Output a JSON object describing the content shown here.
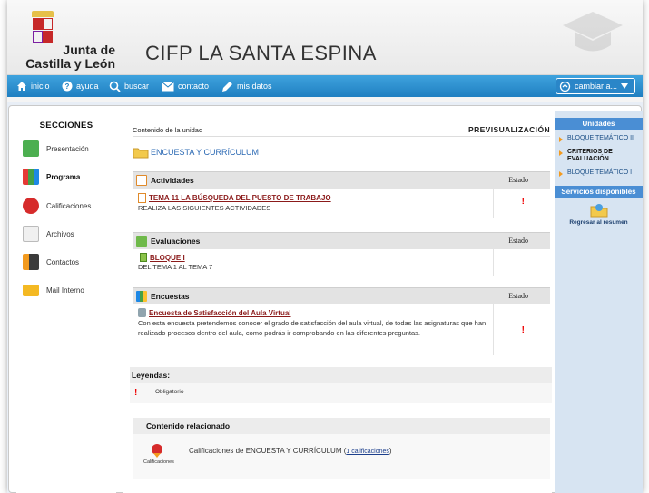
{
  "header": {
    "logo_line1": "Junta de",
    "logo_line2": "Castilla y León",
    "site_title": "CIFP LA SANTA ESPINA"
  },
  "nav": {
    "items": [
      {
        "label": "inicio",
        "icon": "home-icon"
      },
      {
        "label": "ayuda",
        "icon": "help-icon"
      },
      {
        "label": "buscar",
        "icon": "search-icon"
      },
      {
        "label": "contacto",
        "icon": "mail-icon"
      },
      {
        "label": "mis datos",
        "icon": "pencil-icon"
      }
    ],
    "switch_label": "cambiar a..."
  },
  "sidebar": {
    "title": "SECCIONES",
    "items": [
      {
        "label": "Presentación",
        "icon": "presentation-icon",
        "color": "#4caf50"
      },
      {
        "label": "Programa",
        "icon": "program-icon",
        "color": "#3f7fd0"
      },
      {
        "label": "Calificaciones",
        "icon": "grades-icon",
        "color": "#d62b2b"
      },
      {
        "label": "Archivos",
        "icon": "files-icon",
        "color": "#cfcfcf"
      },
      {
        "label": "Contactos",
        "icon": "contacts-icon",
        "color": "#3b3b3b"
      },
      {
        "label": "Mail Interno",
        "icon": "internal-mail-icon",
        "color": "#f4b923"
      }
    ]
  },
  "main": {
    "content_label": "Contenido de la unidad",
    "preview_label": "PREVISUALIZACIÓN",
    "unit_title": "ENCUESTA Y CURRÍCULUM",
    "status_header": "Estado",
    "activities": {
      "title": "Actividades",
      "link": "TEMA 11 LA BÚSQUEDA DEL PUESTO DE TRABAJO",
      "desc": "REALIZA LAS SIGUIENTES ACTIVIDADES",
      "status": "!"
    },
    "evaluations": {
      "title": "Evaluaciones",
      "link": "BLOQUE I",
      "desc": "DEL TEMA 1 AL TEMA 7"
    },
    "surveys": {
      "title": "Encuestas",
      "link": "Encuesta de Satisfacción del Aula Virtual",
      "desc": "Con esta encuesta pretendemos conocer el grado de satisfacción del aula virtual, de todas las asignaturas que han realizado procesos dentro del aula, como podrás ir comprobando en las diferentes preguntas.",
      "status": "!"
    },
    "legend": {
      "title": "Leyendas:",
      "symbol": "!",
      "text": "Obligatorio"
    },
    "related": {
      "title": "Contenido relacionado",
      "icon_caption": "Calificaciones",
      "text": "Calificaciones de ENCUESTA Y CURRÍCULUM",
      "link": "1 calificaciones",
      "open_paren": "(",
      "close_paren": ")"
    }
  },
  "right_panel": {
    "units_title": "Unidades",
    "units": [
      {
        "label": "BLOQUE TEMÁTICO II",
        "active": false
      },
      {
        "label": "CRITERIOS DE EVALUACIÓN",
        "active": true
      },
      {
        "label": "BLOQUE TEMÁTICO I",
        "active": false
      }
    ],
    "services_title": "Servicios disponibles",
    "back_label": "Regresar al resumen"
  },
  "colors": {
    "nav_bg": "#2a8dd0",
    "link_red": "#8b1a1a",
    "unit_blue": "#2a68b3",
    "alert_red": "#e00000",
    "right_header": "#4a8ed4"
  }
}
